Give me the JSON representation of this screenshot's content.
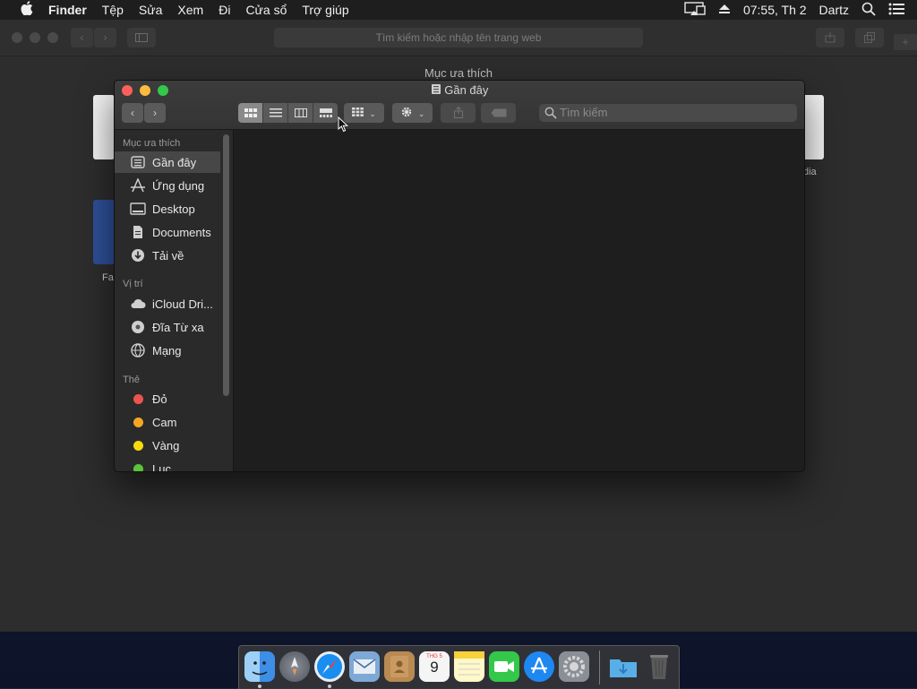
{
  "menubar": {
    "app": "Finder",
    "items": [
      "Tệp",
      "Sửa",
      "Xem",
      "Đi",
      "Cửa sổ",
      "Trợ giúp"
    ],
    "clock": "07:55, Th 2",
    "user": "Dartz",
    "icons": [
      "apple-icon",
      "airplay-icon",
      "eject-icon",
      "search-icon",
      "list-icon"
    ]
  },
  "safari": {
    "address_placeholder": "Tìm kiếm hoặc nhập tên trang web",
    "favorites_title": "Mục ưa thích",
    "partial_labels": [
      "Fa",
      "dia"
    ]
  },
  "finder": {
    "title": "Gần đây",
    "search_placeholder": "Tìm kiếm",
    "sidebar": {
      "favorites_header": "Mục ưa thích",
      "favorites": [
        {
          "label": "Gần đây",
          "icon": "recents-icon",
          "selected": true
        },
        {
          "label": "Ứng dụng",
          "icon": "applications-icon"
        },
        {
          "label": "Desktop",
          "icon": "desktop-icon"
        },
        {
          "label": "Documents",
          "icon": "documents-icon"
        },
        {
          "label": "Tải về",
          "icon": "downloads-icon"
        }
      ],
      "locations_header": "Vị trí",
      "locations": [
        {
          "label": "iCloud Dri...",
          "icon": "icloud-icon"
        },
        {
          "label": "Đĩa Từ xa",
          "icon": "remote-disc-icon"
        },
        {
          "label": "Mạng",
          "icon": "network-icon"
        }
      ],
      "tags_header": "Thẻ",
      "tags": [
        {
          "label": "Đỏ",
          "color": "#ef5350"
        },
        {
          "label": "Cam",
          "color": "#f5a623"
        },
        {
          "label": "Vàng",
          "color": "#f8d90f"
        },
        {
          "label": "Lục",
          "color": "#5ac43a"
        }
      ]
    }
  },
  "dock": {
    "calendar_month": "THG 5",
    "calendar_day": "9",
    "apps": [
      "finder-icon",
      "launchpad-icon",
      "safari-icon",
      "mail-icon",
      "contacts-icon",
      "calendar-icon",
      "notes-icon",
      "facetime-icon",
      "app-store-icon",
      "system-preferences-icon",
      "downloads-folder-icon",
      "trash-icon"
    ]
  }
}
